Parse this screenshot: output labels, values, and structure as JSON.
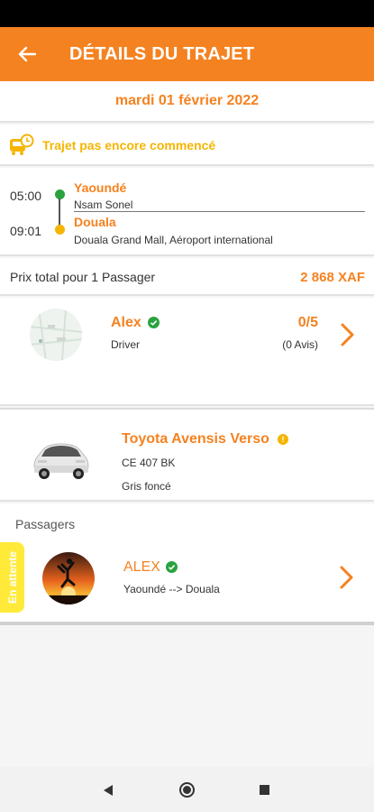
{
  "header": {
    "title": "DÉTAILS DU TRAJET"
  },
  "trip": {
    "date": "mardi 01 février 2022",
    "status": "Trajet pas encore commencé",
    "departure": {
      "time": "05:00",
      "city": "Yaoundé",
      "address": "Nsam Sonel"
    },
    "arrival": {
      "time": "09:01",
      "city": "Douala",
      "address": "Douala Grand Mall, Aéroport international"
    }
  },
  "price": {
    "label": "Prix total pour 1 Passager",
    "value": "2 868 XAF"
  },
  "driver": {
    "name": "Alex",
    "role": "Driver",
    "rating": "0/5",
    "reviews": "(0 Avis)"
  },
  "car": {
    "model": "Toyota Avensis Verso",
    "plate": "CE 407 BK",
    "color": "Gris foncé"
  },
  "passengers": {
    "title": "Passagers",
    "status_tag": "En attente",
    "items": [
      {
        "name": "ALEX",
        "route": "Yaoundé --> Douala"
      }
    ]
  },
  "colors": {
    "accent": "#f58220",
    "status": "#f5b500",
    "verified": "#2aa33f",
    "waiting": "#ffea3a"
  },
  "icons": [
    "back-arrow-icon",
    "bus-clock-icon",
    "verified-icon",
    "chevron-right-icon",
    "info-icon",
    "nav-back-icon",
    "nav-home-icon",
    "nav-recent-icon"
  ]
}
